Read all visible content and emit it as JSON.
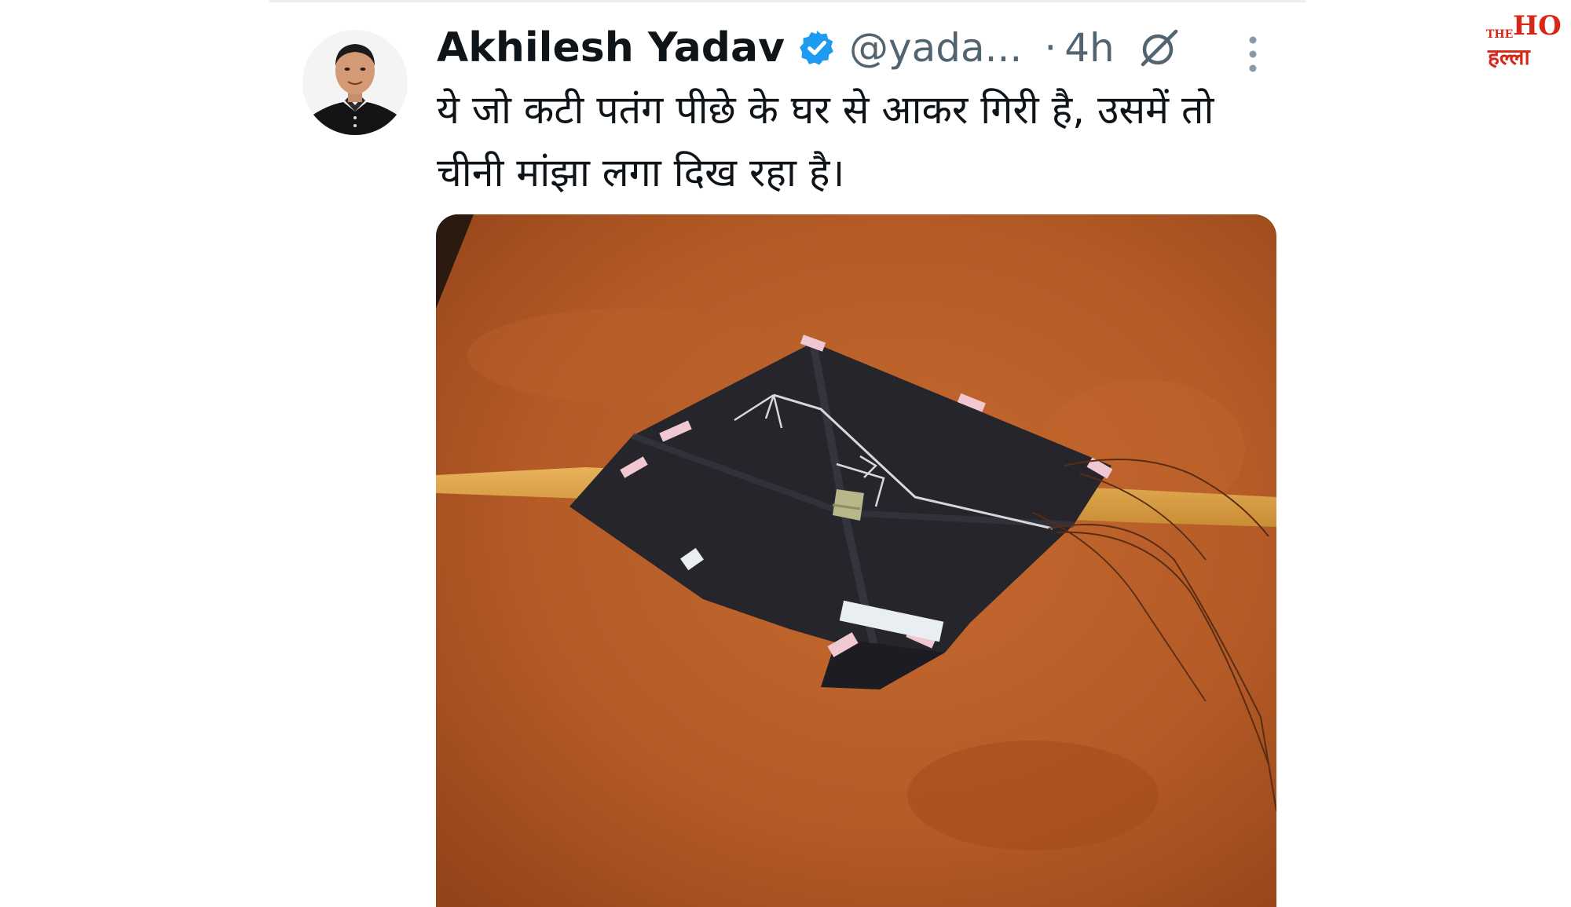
{
  "tweet": {
    "author_name": "Akhilesh Yadav",
    "handle": "@yada...",
    "separator": "·",
    "time": "4h",
    "text": "ये जो कटी पतंग पीछे के घर से आकर गिरी है, उसमें तो चीनी मांझा लगा दिख रहा है।",
    "icons": {
      "verified": "verified-badge-icon",
      "grok": "grok-icon",
      "more": "more-options-icon"
    }
  },
  "logo": {
    "top_text": "THE",
    "main_text": "HO",
    "hindi_text": "हल्ला"
  },
  "colors": {
    "verified_blue": "#1d9bf0",
    "text_primary": "#0f1419",
    "text_secondary": "#536471",
    "logo_red": "#d62718"
  }
}
